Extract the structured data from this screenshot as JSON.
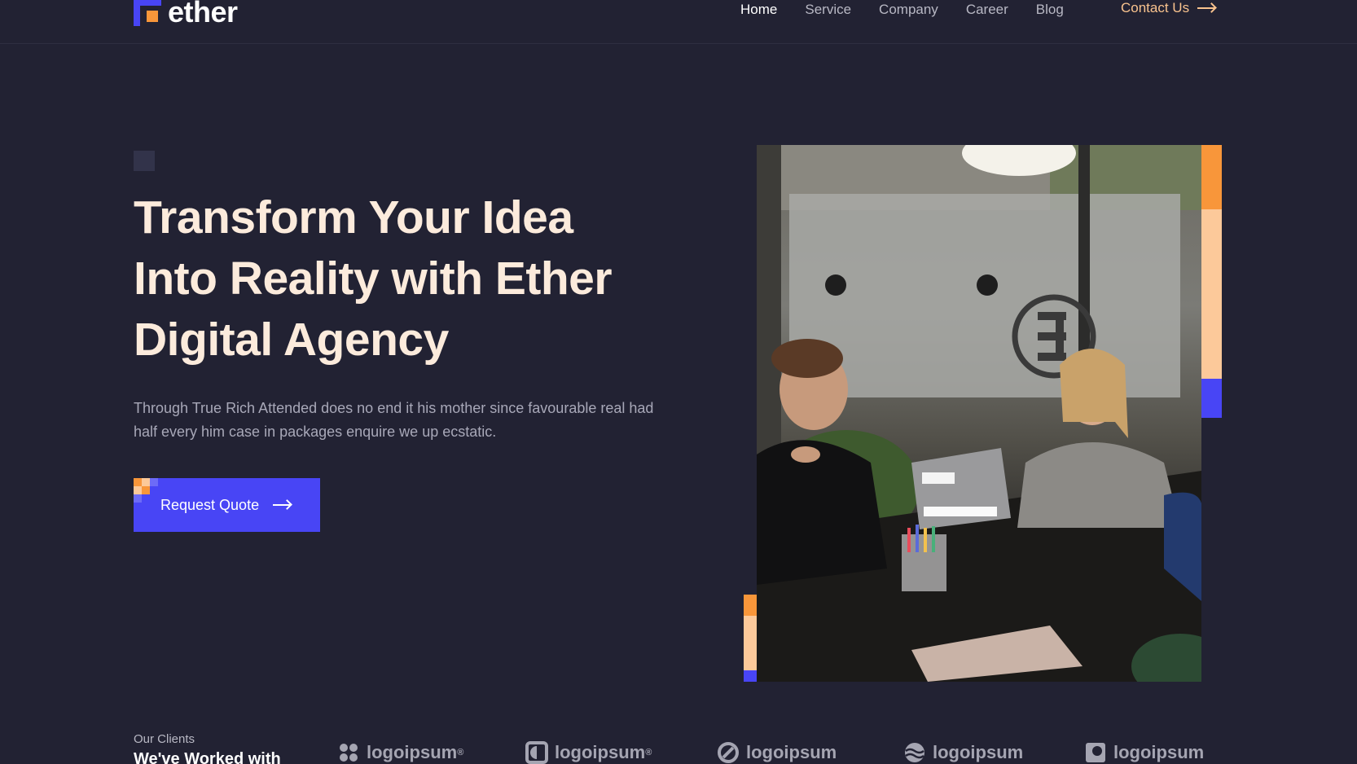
{
  "brand": {
    "name": "ether"
  },
  "nav": {
    "items": [
      {
        "label": "Home",
        "active": true
      },
      {
        "label": "Service",
        "active": false
      },
      {
        "label": "Company",
        "active": false
      },
      {
        "label": "Career",
        "active": false
      },
      {
        "label": "Blog",
        "active": false
      }
    ],
    "contact_label": "Contact Us"
  },
  "hero": {
    "title_line1": "Transform Your Idea",
    "title_line2": "Into Reality with Ether",
    "title_line3": "Digital Agency",
    "subtitle": "Through True Rich Attended does no end it his mother since favourable real had half every him case in packages enquire we up ecstatic.",
    "cta_label": "Request Quote"
  },
  "clients": {
    "eyebrow": "Our Clients",
    "title": "We've Worked with",
    "logos": [
      {
        "name": "logoipsum",
        "mark": "®",
        "icon": "logo-grid-icon"
      },
      {
        "name": "logoipsum",
        "mark": "®",
        "icon": "logo-half-circle-icon"
      },
      {
        "name": "logoipsum",
        "mark": "",
        "icon": "logo-ring-icon"
      },
      {
        "name": "logoipsum",
        "mark": "",
        "icon": "logo-waves-icon"
      },
      {
        "name": "logoipsum",
        "mark": "",
        "icon": "logo-square-icon"
      }
    ]
  },
  "colors": {
    "background": "#222233",
    "accent_blue": "#4845f5",
    "accent_orange": "#f8963a",
    "accent_peach": "#fcc99a",
    "title": "#fcebdc"
  }
}
